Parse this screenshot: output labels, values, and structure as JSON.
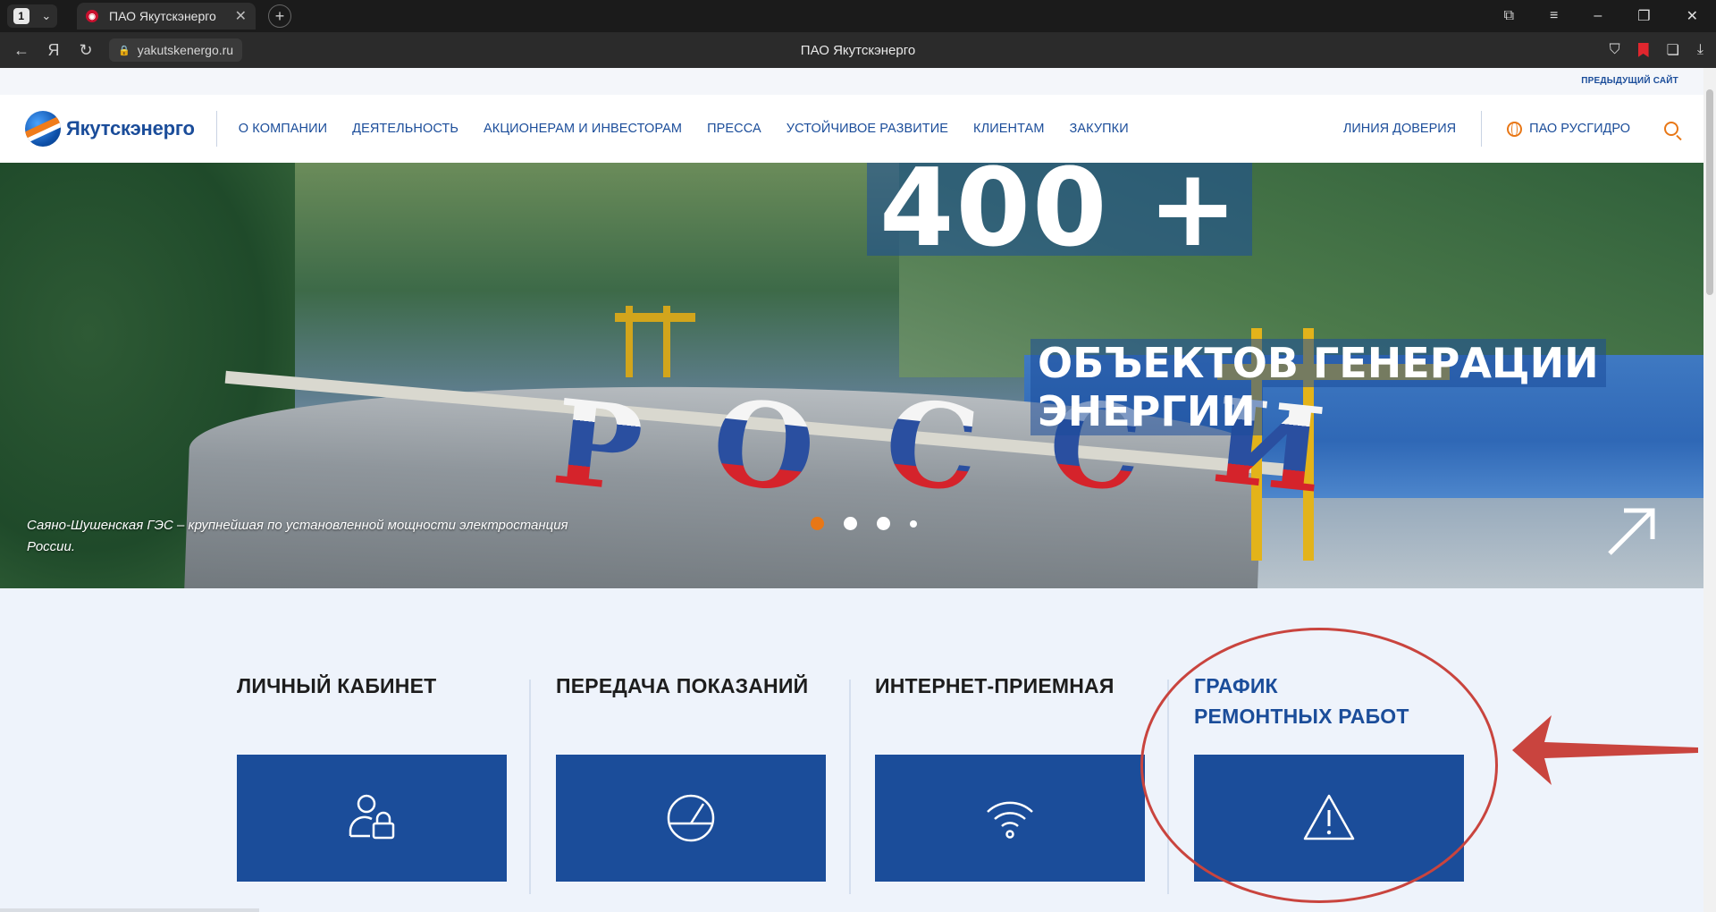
{
  "browser": {
    "tab_count": "1",
    "tab_title": "ПАО Якутскэнерго",
    "url": "yakutskenergo.ru",
    "page_title": "ПАО Якутскэнерго",
    "icons": [
      "back-icon",
      "yandex-icon",
      "reload-icon",
      "lock-icon",
      "bookmark-icon",
      "downloads-icon"
    ]
  },
  "site": {
    "prev_site": "ПРЕДЫДУЩИЙ САЙТ",
    "logo": "Якутскэнерго",
    "menu": [
      "О КОМПАНИИ",
      "ДЕЯТЕЛЬНОСТЬ",
      "АКЦИОНЕРАМ И ИНВЕСТОРАМ",
      "ПРЕССА",
      "УСТОЙЧИВОЕ РАЗВИТИЕ",
      "КЛИЕНТАМ",
      "ЗАКУПКИ"
    ],
    "trust_line": "ЛИНИЯ ДОВЕРИЯ",
    "rushydro": "ПАО РУСГИДРО",
    "accent_color": "#e87716",
    "brand_color": "#1b4d9a"
  },
  "hero": {
    "stat_number": "400 +",
    "stat_line1": "ОБЪЕКТОВ ГЕНЕРАЦИИ",
    "stat_line2": "ЭНЕРГИИ",
    "dam_lettering": [
      "Р",
      "О",
      "С",
      "С",
      "И"
    ],
    "caption": "Саяно-Шушенская ГЭС – крупнейшая по установленной мощности электростанция России.",
    "slider_active_index": 0,
    "slider_count": 4
  },
  "services": [
    {
      "title": "ЛИЧНЫЙ КАБИНЕТ",
      "icon": "user-lock-icon"
    },
    {
      "title": "ПЕРЕДАЧА ПОКАЗАНИЙ",
      "icon": "gauge-icon"
    },
    {
      "title": "ИНТЕРНЕТ-ПРИЕМНАЯ",
      "icon": "wifi-icon"
    },
    {
      "title": "ГРАФИК\nРЕМОНТНЫХ РАБОТ",
      "icon": "warning-icon"
    }
  ],
  "annotation_color": "#c9443e"
}
